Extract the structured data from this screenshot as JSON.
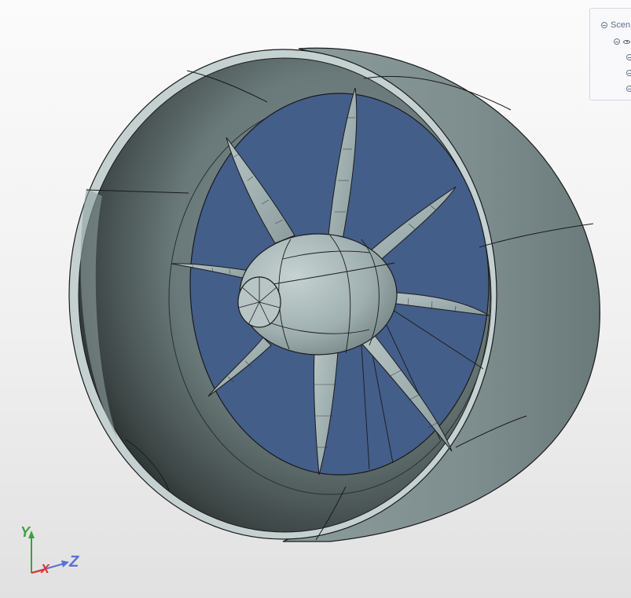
{
  "scene_tree": {
    "root_label": "Scen"
  },
  "axes": {
    "x_label": "X",
    "y_label": "Y",
    "z_label": "Z",
    "x_color": "#d9342b",
    "y_color": "#3f9e3f",
    "z_color": "#5b6fd6"
  },
  "model": {
    "shroud_color": "#aab8b8",
    "blade_color": "#a8b6b6",
    "inlet_color": "#445e8a"
  }
}
